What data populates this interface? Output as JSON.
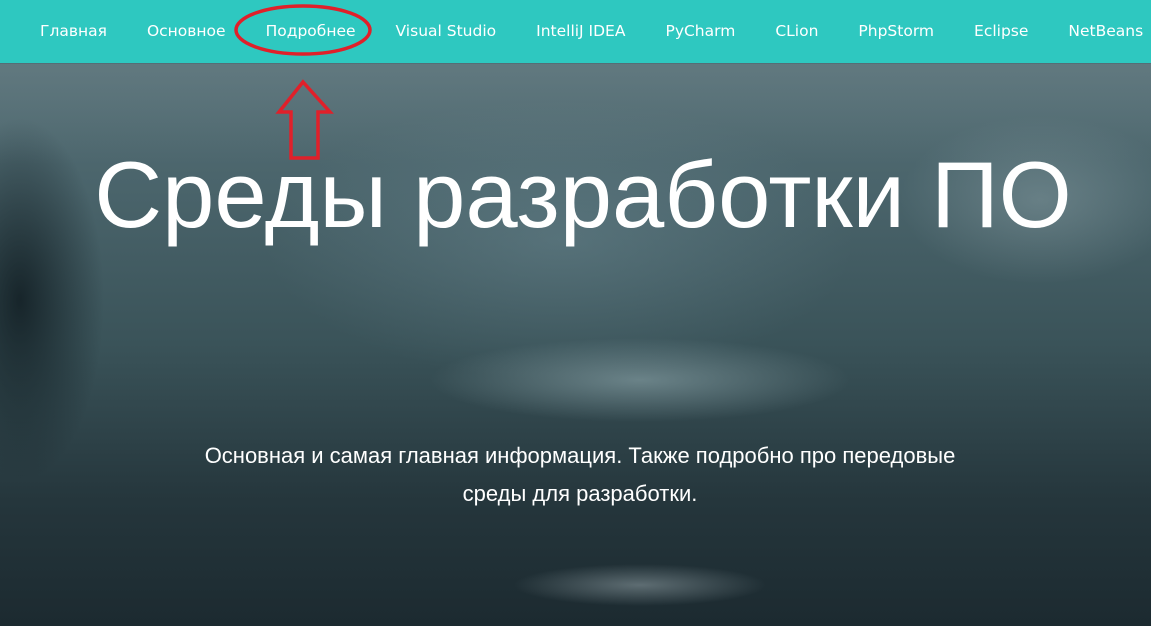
{
  "nav": {
    "items": [
      {
        "label": "Главная"
      },
      {
        "label": "Основное"
      },
      {
        "label": "Подробнее"
      },
      {
        "label": "Visual Studio"
      },
      {
        "label": "IntelliJ IDEA"
      },
      {
        "label": "PyCharm"
      },
      {
        "label": "CLion"
      },
      {
        "label": "PhpStorm"
      },
      {
        "label": "Eclipse"
      },
      {
        "label": "NetBeans"
      }
    ],
    "highlighted_item": "Подробнее"
  },
  "hero": {
    "title": "Среды разработки ПО",
    "subtitle": "Основная и самая главная информация. Также подробно про передовые\nсреды для разработки."
  },
  "colors": {
    "nav_background": "#2ec8c0",
    "nav_text": "#ffffff",
    "annotation": "#e0202a",
    "hero_text": "#ffffff"
  },
  "icons": {
    "annotation_shape": "red-ellipse",
    "annotation_arrow": "up-arrow-icon"
  }
}
